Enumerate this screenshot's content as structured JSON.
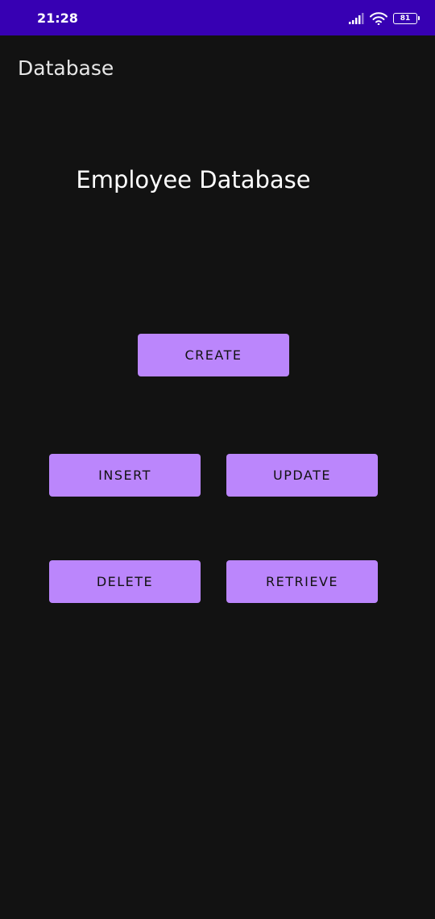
{
  "status_bar": {
    "time": "21:28",
    "battery_level": "81",
    "icons": [
      "signal-icon",
      "wifi-icon",
      "battery-icon"
    ],
    "background_color": "#3700b3"
  },
  "app_bar": {
    "title": "Database"
  },
  "main": {
    "heading": "Employee Database",
    "buttons": {
      "create": "CREATE",
      "insert": "INSERT",
      "update": "UPDATE",
      "delete": "DELETE",
      "retrieve": "RETRIEVE"
    }
  },
  "colors": {
    "background": "#121212",
    "button": "#bb86fc",
    "button_text": "#121212"
  }
}
